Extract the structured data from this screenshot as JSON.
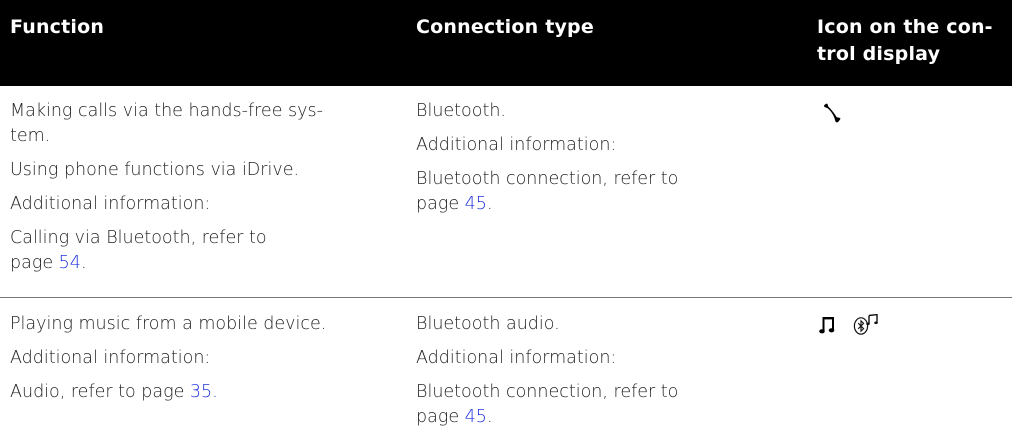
{
  "header": {
    "function": "Function",
    "connection_type": "Connection type",
    "icon_line1": "Icon on the con-",
    "icon_line2": "trol display"
  },
  "rows": [
    {
      "function": {
        "p1_line1": "Making calls via the hands-free sys-",
        "p1_line2": "tem.",
        "p2": "Using phone functions via iDrive.",
        "p3": "Additional information:",
        "p4_line1": "Calling via Bluetooth, refer to",
        "p4_prefix": "page ",
        "p4_link": "54",
        "p4_suffix": "."
      },
      "connection": {
        "p1": "Bluetooth.",
        "p2": "Additional information:",
        "p3_line1": "Bluetooth connection, refer to",
        "p3_prefix": "page ",
        "p3_link": "45",
        "p3_suffix": "."
      },
      "icons": [
        "phone-icon"
      ]
    },
    {
      "function": {
        "p1": "Playing music from a mobile device.",
        "p2": "Additional information:",
        "p3_prefix": "Audio, refer to page ",
        "p3_link": "35",
        "p3_suffix": "."
      },
      "connection": {
        "p1": "Bluetooth audio.",
        "p2": "Additional information:",
        "p3_line1": "Bluetooth connection, refer to",
        "p3_prefix": "page ",
        "p3_link": "45",
        "p3_suffix": "."
      },
      "icons": [
        "music-note-icon",
        "bluetooth-audio-icon"
      ]
    }
  ],
  "colors": {
    "header_bg": "#000000",
    "header_text": "#ffffff",
    "link": "#2233dd",
    "divider": "#777777"
  }
}
